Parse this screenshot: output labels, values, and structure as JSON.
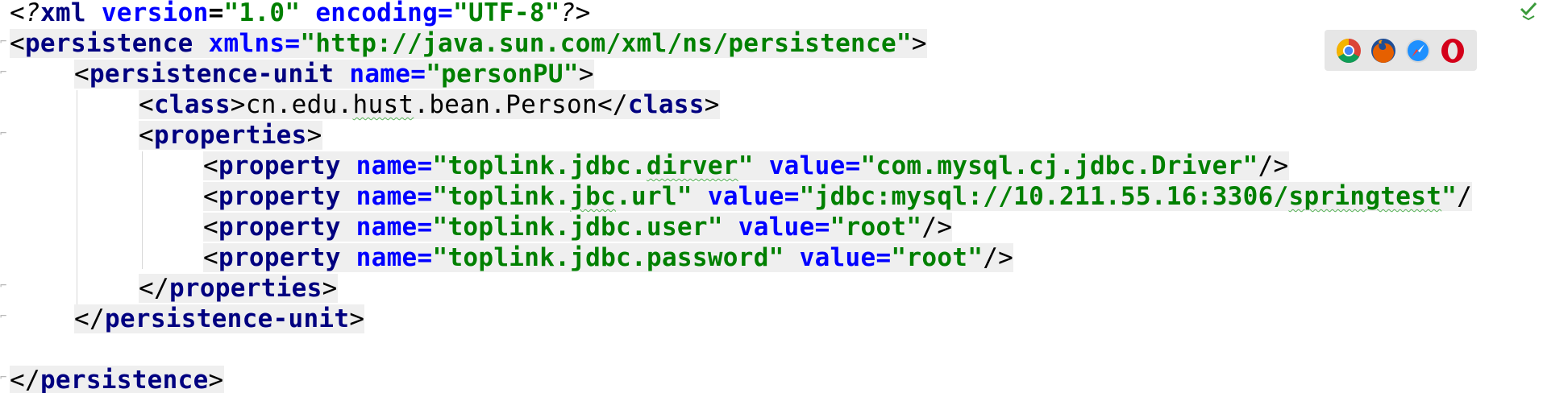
{
  "editor": {
    "lines": [
      {
        "parts": [
          "<",
          "?",
          "xml",
          " ",
          "version",
          "=",
          "\"1.0\"",
          " ",
          "encoding",
          "=",
          "\"UTF-8\"",
          "?",
          ">"
        ]
      },
      {
        "parts": [
          "<",
          "persistence",
          " ",
          "xmlns",
          "=",
          "\"http://java.sun.com/xml/ns/persistence\"",
          ">"
        ]
      },
      {
        "parts": [
          "<",
          "persistence-unit",
          " ",
          "name",
          "=",
          "\"personPU\"",
          ">"
        ]
      },
      {
        "parts": [
          "<",
          "class",
          ">",
          "cn.edu.",
          "hust",
          ".bean.Person",
          "</",
          "class",
          ">"
        ]
      },
      {
        "parts": [
          "<",
          "properties",
          ">"
        ]
      },
      {
        "parts": [
          "<",
          "property",
          " ",
          "name",
          "=",
          "\"toplink.jdbc.",
          "dirver",
          "\"",
          " ",
          "value",
          "=",
          "\"com.mysql.cj.jdbc.Driver\"",
          "/>"
        ]
      },
      {
        "parts": [
          "<",
          "property",
          " ",
          "name",
          "=",
          "\"toplink.",
          "jbc",
          ".url\"",
          " ",
          "value",
          "=",
          "\"jdbc:mysql://10.211.55.16:3306/",
          "springtest",
          "\"",
          "/"
        ]
      },
      {
        "parts": [
          "<",
          "property",
          " ",
          "name",
          "=",
          "\"toplink.jdbc.user\"",
          " ",
          "value",
          "=",
          "\"root\"",
          "/>"
        ]
      },
      {
        "parts": [
          "<",
          "property",
          " ",
          "name",
          "=",
          "\"toplink.jdbc.password\"",
          " ",
          "value",
          "=",
          "\"root\"",
          "/>"
        ]
      },
      {
        "parts": [
          "</",
          "properties",
          ">"
        ]
      },
      {
        "parts": [
          "</",
          "persistence-unit",
          ">"
        ]
      },
      {
        "parts": []
      },
      {
        "parts": [
          "</",
          "persistence",
          ">"
        ]
      }
    ]
  },
  "browser_bar": {
    "icons": [
      "chrome-icon",
      "firefox-icon",
      "safari-icon",
      "opera-icon"
    ]
  },
  "status": {
    "icon": "inspection-ok-icon",
    "color": "#3a9a3a"
  },
  "colors": {
    "tag": "#000080",
    "attribute": "#0000ff",
    "value": "#008000",
    "highlight": "#efefef"
  }
}
